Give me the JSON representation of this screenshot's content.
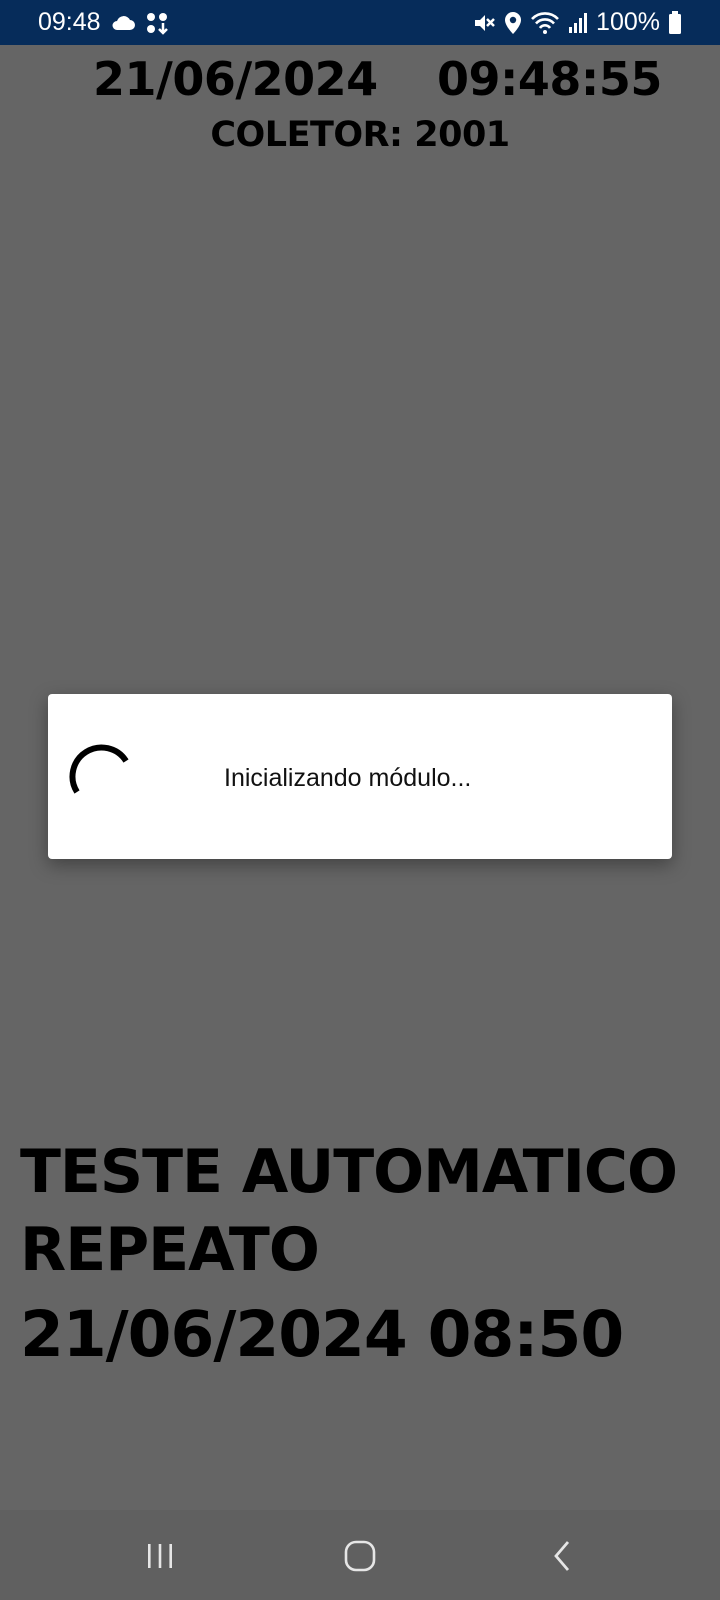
{
  "status_bar": {
    "time": "09:48",
    "battery_percent": "100%",
    "left_icons": [
      "cloud-icon",
      "app-notification-icon"
    ],
    "right_icons": [
      "mute-icon",
      "location-icon",
      "wifi-icon",
      "signal-icon",
      "battery-icon"
    ],
    "background_color": "#062c5a"
  },
  "header": {
    "date": "21/06/2024",
    "time": "09:48:55",
    "collector": "COLETOR: 2001"
  },
  "dialog": {
    "message": "Inicializando módulo...",
    "icon": "loading-spinner-icon"
  },
  "main": {
    "title": "TESTE AUTOMATICO REPEATO",
    "datetime": "21/06/2024 08:50"
  },
  "nav_bar": {
    "buttons": [
      "recent-apps-icon",
      "home-icon",
      "back-icon"
    ]
  },
  "colors": {
    "scrim_background": "#656565",
    "dialog_background": "#ffffff"
  }
}
